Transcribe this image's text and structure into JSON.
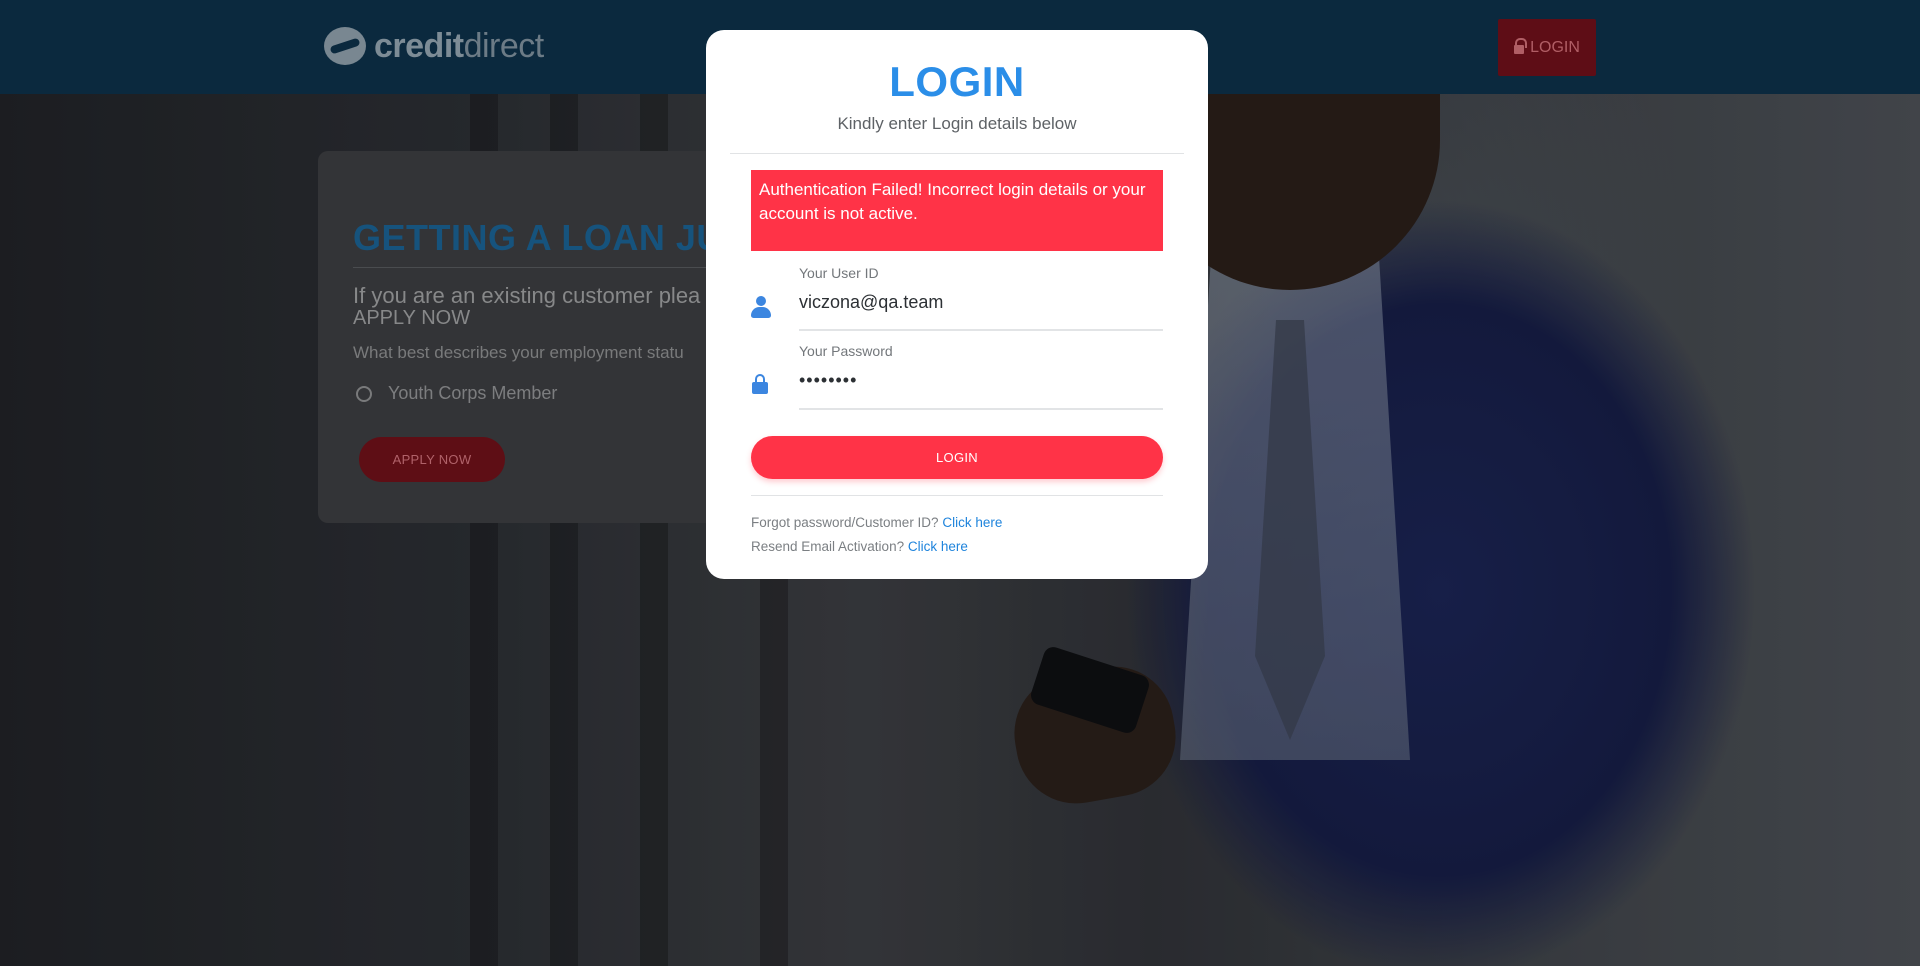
{
  "header": {
    "logo": {
      "part1": "credit",
      "part2": "direct"
    },
    "login_label": "LOGIN"
  },
  "loan_card": {
    "title": "GETTING A LOAN JUST G",
    "existing_line": "If you are an existing customer plea",
    "apply_now_text": "APPLY NOW",
    "employment_question": "What best describes your employment statu",
    "radio_option": "Youth Corps Member",
    "apply_button": "APPLY NOW"
  },
  "modal": {
    "title": "LOGIN",
    "subtitle": "Kindly enter Login details below",
    "alert": "Authentication Failed! Incorrect login details or your account is not active.",
    "user_id": {
      "label": "Your User ID",
      "value": "viczona@qa.team"
    },
    "password": {
      "label": "Your Password",
      "value": "••••••••"
    },
    "login_button": "LOGIN",
    "forgot": {
      "text": "Forgot password/Customer ID?",
      "link": "Click here"
    },
    "resend": {
      "text": "Resend Email Activation?",
      "link": "Click here"
    }
  },
  "colors": {
    "brand_blue": "#2b8ee8",
    "alert_red": "#ff3347",
    "header_bg": "#0d2f47"
  }
}
